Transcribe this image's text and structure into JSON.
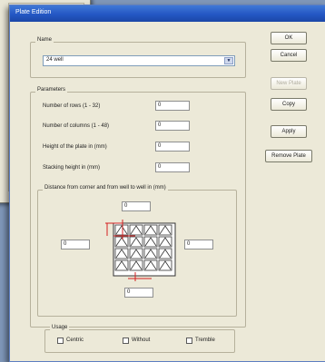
{
  "window": {
    "title": "Plate Edition"
  },
  "name_group": {
    "label": "Name",
    "selected": "24 well"
  },
  "parameters": {
    "label": "Parameters",
    "rows_label": "Number of rows (1 - 32)",
    "rows_value": "0",
    "cols_label": "Number of columns (1 - 48)",
    "cols_value": "0",
    "height_label": "Height of the plate in (mm)",
    "height_value": "0",
    "stacking_label": "Stacking height in (mm)",
    "stacking_value": "0"
  },
  "distance": {
    "label": "Distance from corner and from well to well in (mm)",
    "top_value": "0",
    "left_value": "0",
    "right_value": "0",
    "bottom_value": "0"
  },
  "usage": {
    "label": "Usage",
    "options": [
      "Centric",
      "Without",
      "Tremble"
    ]
  },
  "buttons": {
    "ok": "OK",
    "cancel": "Cancel",
    "new_plate": "New Plate",
    "copy": "Copy",
    "apply": "Apply",
    "remove_plate": "Remove Plate"
  },
  "colors": {
    "title_bar": "#2457c4",
    "marker": "#d42020",
    "dialog_bg": "#ece9d8"
  }
}
